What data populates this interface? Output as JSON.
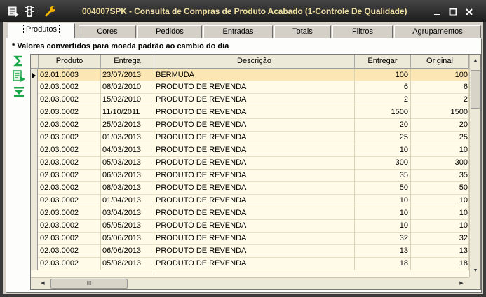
{
  "window": {
    "title": "004007SPK - Consulta de Compras de Produto Acabado (1-Controle De Qualidade)"
  },
  "tabs": [
    {
      "label": "Produtos"
    },
    {
      "label": "Cores"
    },
    {
      "label": "Pedidos"
    },
    {
      "label": "Entradas"
    },
    {
      "label": "Totais"
    },
    {
      "label": "Filtros"
    },
    {
      "label": "Agrupamentos"
    }
  ],
  "note": "* Valores convertidos para moeda padrão ao cambio do dia",
  "columns": [
    "Produto",
    "Entrega",
    "Descrição",
    "Entregar",
    "Original"
  ],
  "rows": [
    [
      "02.01.0003",
      "23/07/2013",
      "BERMUDA",
      "100",
      "100"
    ],
    [
      "02.03.0002",
      "08/02/2010",
      "PRODUTO DE REVENDA",
      "6",
      "6"
    ],
    [
      "02.03.0002",
      "15/02/2010",
      "PRODUTO DE REVENDA",
      "2",
      "2"
    ],
    [
      "02.03.0002",
      "11/10/2011",
      "PRODUTO DE REVENDA",
      "1500",
      "1500"
    ],
    [
      "02.03.0002",
      "25/02/2013",
      "PRODUTO DE REVENDA",
      "20",
      "20"
    ],
    [
      "02.03.0002",
      "01/03/2013",
      "PRODUTO DE REVENDA",
      "25",
      "25"
    ],
    [
      "02.03.0002",
      "04/03/2013",
      "PRODUTO DE REVENDA",
      "10",
      "10"
    ],
    [
      "02.03.0002",
      "05/03/2013",
      "PRODUTO DE REVENDA",
      "300",
      "300"
    ],
    [
      "02.03.0002",
      "06/03/2013",
      "PRODUTO DE REVENDA",
      "35",
      "35"
    ],
    [
      "02.03.0002",
      "08/03/2013",
      "PRODUTO DE REVENDA",
      "50",
      "50"
    ],
    [
      "02.03.0002",
      "01/04/2013",
      "PRODUTO DE REVENDA",
      "10",
      "10"
    ],
    [
      "02.03.0002",
      "03/04/2013",
      "PRODUTO DE REVENDA",
      "10",
      "10"
    ],
    [
      "02.03.0002",
      "05/05/2013",
      "PRODUTO DE REVENDA",
      "10",
      "10"
    ],
    [
      "02.03.0002",
      "05/06/2013",
      "PRODUTO DE REVENDA",
      "32",
      "32"
    ],
    [
      "02.03.0002",
      "06/06/2013",
      "PRODUTO DE REVENDA",
      "13",
      "13"
    ],
    [
      "02.03.0002",
      "05/08/2013",
      "PRODUTO DE REVENDA",
      "18",
      "18"
    ]
  ],
  "selected_row": 0,
  "icons": {
    "titlebar": [
      "menu-icon",
      "traffic-light-icon",
      "wrench-icon"
    ],
    "side": [
      "sigma-icon",
      "export-icon",
      "expand-down-icon"
    ],
    "window": [
      "minimize-icon",
      "maximize-icon",
      "close-icon"
    ]
  },
  "colors": {
    "title_text": "#f0e0a0",
    "grid_bg": "#fffbe8",
    "selected_row": "#fbe6b4",
    "side_icon": "#1aa84a"
  }
}
